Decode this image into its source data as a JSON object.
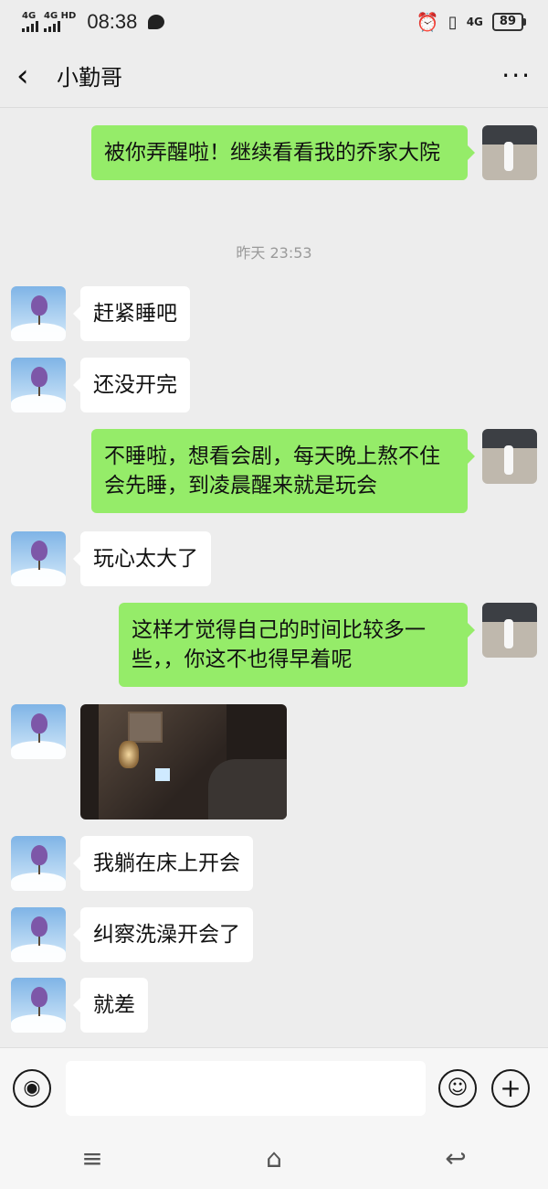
{
  "status_bar": {
    "network_1": "4G",
    "network_2": "4G HD",
    "time": "08:38",
    "network_3": "4G",
    "battery": "89"
  },
  "header": {
    "back_icon": "chevron-left-icon",
    "title": "小勤哥",
    "more_icon": "ellipsis-icon"
  },
  "messages": [
    {
      "side": "out",
      "text": "被你弄醒啦！继续看看我的乔家大院"
    },
    {
      "type": "timestamp",
      "text": "昨天 23:53"
    },
    {
      "side": "in",
      "text": "赶紧睡吧"
    },
    {
      "side": "in",
      "text": "还没开完"
    },
    {
      "side": "out",
      "text": "不睡啦，想看会剧，每天晚上熬不住会先睡，到凌晨醒来就是玩会"
    },
    {
      "side": "in",
      "text": "玩心太大了"
    },
    {
      "side": "out",
      "text": "这样才觉得自己的时间比较多一些，，你这不也得早着呢"
    },
    {
      "side": "in",
      "type": "image",
      "description": "dim hotel room photo"
    },
    {
      "side": "in",
      "text": "我躺在床上开会"
    },
    {
      "side": "in",
      "text": "纠察洗澡开会了"
    },
    {
      "side": "in",
      "text": "就差"
    }
  ],
  "input_bar": {
    "voice_icon": "voice-icon",
    "emoji_icon": "emoji-icon",
    "plus_icon": "plus-icon",
    "placeholder": ""
  },
  "nav_bar": {
    "menu_icon": "menu-icon",
    "home_icon": "home-icon",
    "back_icon": "back-icon"
  },
  "colors": {
    "background": "#ededed",
    "outgoing_bubble": "#95ec69",
    "incoming_bubble": "#ffffff"
  }
}
